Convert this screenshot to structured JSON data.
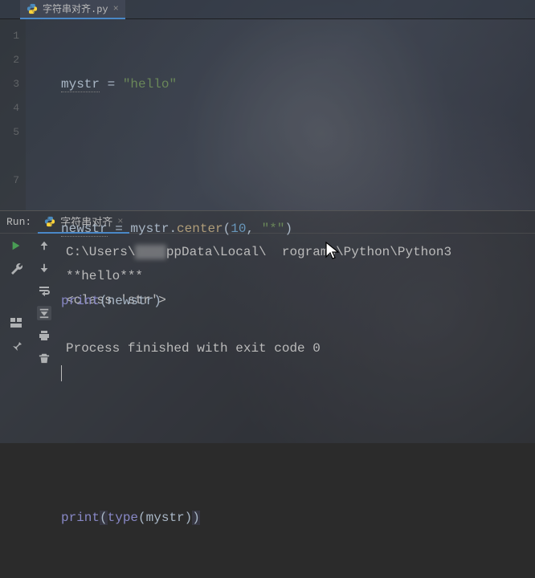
{
  "editor_tab": {
    "filename": "字符串对齐.py"
  },
  "gutter_lines": [
    "1",
    "2",
    "3",
    "4",
    "5",
    "",
    "7"
  ],
  "code": {
    "l1_var": "mystr",
    "l1_eq": " = ",
    "l1_str": "\"hello\"",
    "l3_var": "newstr",
    "l3_eq": " = ",
    "l3_rhs_obj": "mystr",
    "l3_dot": ".",
    "l3_method": "center",
    "l3_paren_open": "(",
    "l3_arg1": "10",
    "l3_comma": ", ",
    "l3_arg2": "\"*\"",
    "l3_paren_close": ")",
    "l4_print": "print",
    "l4_open": "(",
    "l4_arg": "newstr",
    "l4_close": ")",
    "l7_print": "print",
    "l7_open": "(",
    "l7_type": "type",
    "l7_inner_open": "(",
    "l7_arg": "mystr",
    "l7_inner_close": ")",
    "l7_close": ")"
  },
  "run": {
    "label": "Run:",
    "tab_name": "字符串对齐"
  },
  "console": {
    "line1_prefix": "C:\\Users\\",
    "line1_blur": "████",
    "line1_suffix": "ppData\\Local\\  rograms\\Python\\Python3",
    "line2": "**hello***",
    "line3": "<class 'str'>",
    "line4": "",
    "line5": "Process finished with exit code 0"
  }
}
